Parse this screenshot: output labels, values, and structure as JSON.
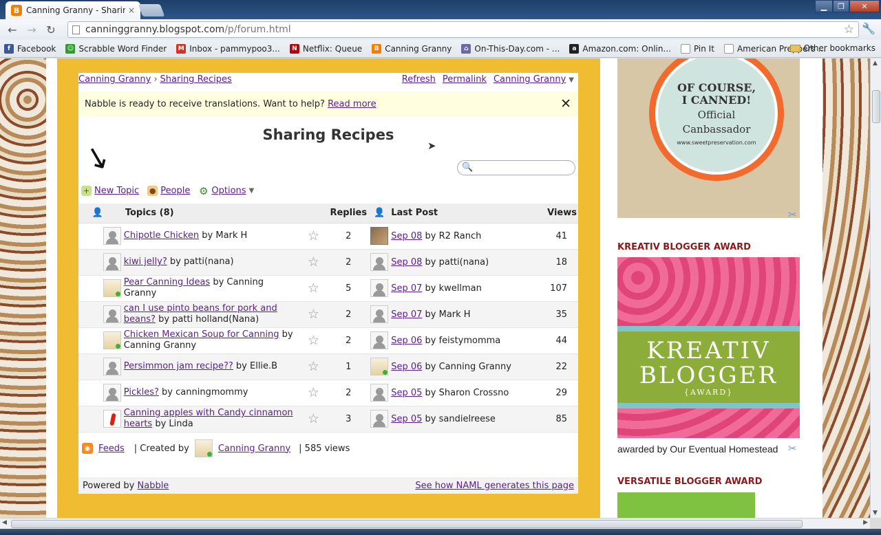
{
  "browser": {
    "tab_title": "Canning Granny - Sharing",
    "tab_close": "×",
    "url_host": "canninggranny.blogspot.com",
    "url_path": "/p/forum.html"
  },
  "bookmarks": [
    {
      "label": "Facebook",
      "color": "#3b5998",
      "glyph": "f"
    },
    {
      "label": "Scrabble Word Finder",
      "color": "#2f9e2f",
      "glyph": "☺"
    },
    {
      "label": "Inbox - pammypoo3...",
      "color": "#d93025",
      "glyph": "M"
    },
    {
      "label": "Netflix: Queue",
      "color": "#b20710",
      "glyph": "N"
    },
    {
      "label": "Canning Granny",
      "color": "#f57d00",
      "glyph": "B"
    },
    {
      "label": "On-This-Day.com - ...",
      "color": "#6a6aa8",
      "glyph": "⌂"
    },
    {
      "label": "Amazon.com: Onlin...",
      "color": "#222222",
      "glyph": "a"
    },
    {
      "label": "Pin It",
      "color": "#ffffff",
      "glyph": ""
    },
    {
      "label": "American Preppers ...",
      "color": "#ffffff",
      "glyph": ""
    }
  ],
  "bookmarks_other": "Other bookmarks",
  "forum": {
    "breadcrumb_root": "Canning Granny",
    "breadcrumb_sep": "›",
    "breadcrumb_current": "Sharing Recipes",
    "top_links": {
      "refresh": "Refresh",
      "permalink": "Permalink",
      "owner": "Canning Granny"
    },
    "notice_text": "Nabble is ready to receive translations. Want to help?",
    "notice_link": "Read more",
    "notice_close": "✕",
    "title": "Sharing Recipes",
    "actions": {
      "new_topic": "New Topic",
      "people": "People",
      "options": "Options"
    },
    "columns": {
      "topics": "Topics (8)",
      "replies": "Replies",
      "last_post": "Last Post",
      "views": "Views"
    },
    "topics": [
      {
        "title": "Chipotle Chicken",
        "by": "by Mark H",
        "avatar": "default",
        "replies": "2",
        "last_date": "Sep 08",
        "last_by": "by R2 Ranch",
        "last_avatar": "photo",
        "views": "41"
      },
      {
        "title": "kiwi jelly?",
        "by": "by patti(nana)",
        "avatar": "default",
        "replies": "2",
        "last_date": "Sep 08",
        "last_by": "by patti(nana)",
        "last_avatar": "default",
        "views": "18"
      },
      {
        "title": "Pear Canning Ideas",
        "by": "by Canning Granny",
        "avatar": "granny",
        "replies": "5",
        "last_date": "Sep 07",
        "last_by": "by kwellman",
        "last_avatar": "default",
        "views": "107"
      },
      {
        "title": "can I use pinto beans for pork and beans?",
        "by": "by patti holland(Nana)",
        "avatar": "default",
        "replies": "2",
        "last_date": "Sep 07",
        "last_by": "by Mark H",
        "last_avatar": "default",
        "views": "35"
      },
      {
        "title": "Chicken Mexican Soup for Canning",
        "by": "by Canning Granny",
        "avatar": "granny",
        "replies": "2",
        "last_date": "Sep 06",
        "last_by": "by feistymomma",
        "last_avatar": "default",
        "views": "44"
      },
      {
        "title": "Persimmon jam recipe??",
        "by": "by Ellie.B",
        "avatar": "default",
        "replies": "1",
        "last_date": "Sep 06",
        "last_by": "by Canning Granny",
        "last_avatar": "granny",
        "views": "22"
      },
      {
        "title": "Pickles?",
        "by": "by canningmommy",
        "avatar": "default",
        "replies": "2",
        "last_date": "Sep 05",
        "last_by": "by Sharon Crossno",
        "last_avatar": "default",
        "views": "29"
      },
      {
        "title": "Canning apples with Candy cinnamon hearts",
        "by": "by Linda",
        "avatar": "pepper",
        "replies": "3",
        "last_date": "Sep 05",
        "last_by": "by sandielreese",
        "last_avatar": "default",
        "views": "85"
      }
    ],
    "footer": {
      "feeds": "Feeds",
      "created_by": "| Created by",
      "creator": "Canning Granny",
      "views": "| 585 views"
    },
    "powered_by": "Powered by",
    "powered_link": "Nabble",
    "naml_link": "See how NAML generates this page"
  },
  "sidebar": {
    "badge_line1": "OF COURSE,",
    "badge_line2": "I CANNED!",
    "badge_line3": "Official",
    "badge_line4": "Canbassador",
    "badge_line5": "www.sweetpreservation.com",
    "kreativ_title": "KREATIV BLOGGER AWARD",
    "kreativ_k": "KREATIV",
    "kreativ_b": "BLOGGER",
    "kreativ_award": "{AWARD}",
    "awarded_by": "awarded by Our Eventual Homestead",
    "versatile_title": "VERSATILE BLOGGER AWARD"
  }
}
